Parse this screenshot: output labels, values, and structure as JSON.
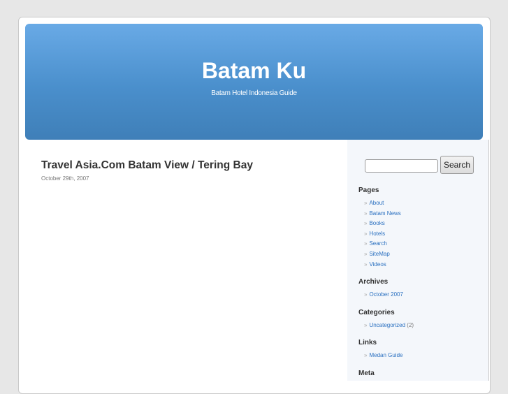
{
  "header": {
    "title": "Batam Ku",
    "description": "Batam Hotel Indonesia Guide"
  },
  "post": {
    "title": "Travel Asia.Com Batam View / Tering Bay",
    "date": "October 29th, 2007"
  },
  "sidebar": {
    "search_button": "Search",
    "search_value": "",
    "pages": {
      "title": "Pages",
      "items": [
        "About",
        "Batam News",
        "Books",
        "Hotels",
        "Search",
        "SiteMap",
        "Videos"
      ]
    },
    "archives": {
      "title": "Archives",
      "items": [
        "October 2007"
      ]
    },
    "categories": {
      "title": "Categories",
      "items": [
        {
          "label": "Uncategorized",
          "count": "(2)"
        }
      ]
    },
    "links": {
      "title": "Links",
      "items": [
        "Medan Guide"
      ]
    },
    "meta": {
      "title": "Meta"
    }
  }
}
